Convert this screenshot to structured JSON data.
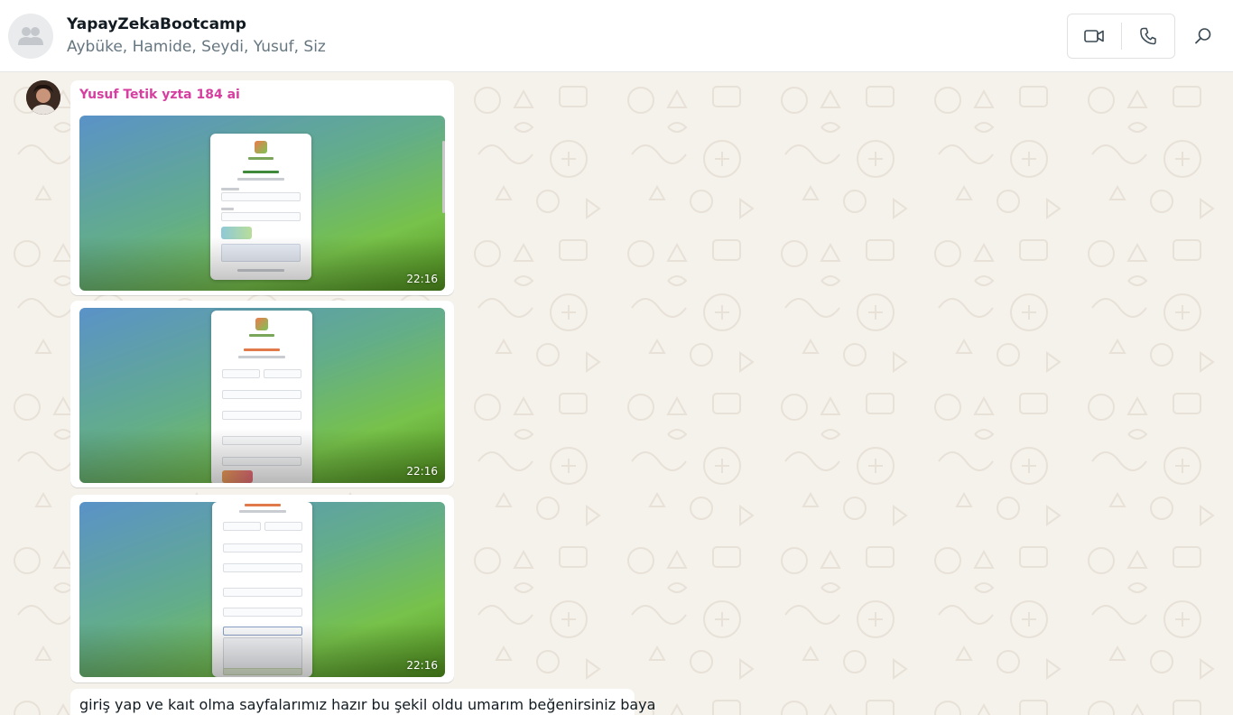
{
  "header": {
    "title": "YapayZekaBootcamp",
    "members": "Aybüke, Hamide, Seydi, Yusuf, Siz",
    "avatar_icon": "group-icon",
    "video_call_icon": "video-camera-icon",
    "voice_call_icon": "phone-icon",
    "search_icon": "search-icon"
  },
  "messages": [
    {
      "sender": "Yusuf Tetik yzta 184 ai",
      "sender_color": "#d63fa0",
      "type": "image",
      "time": "22:16"
    },
    {
      "type": "image",
      "time": "22:16"
    },
    {
      "type": "image",
      "time": "22:16"
    },
    {
      "type": "text",
      "text": "giriş yap ve kaıt olma sayfalarımız hazır bu şekil oldu umarım beğenirsiniz baya"
    }
  ],
  "colors": {
    "header_bg": "#ffffff",
    "chat_bg": "#f5f1eb",
    "bubble_bg": "#ffffff",
    "sender_name": "#d63fa0"
  }
}
